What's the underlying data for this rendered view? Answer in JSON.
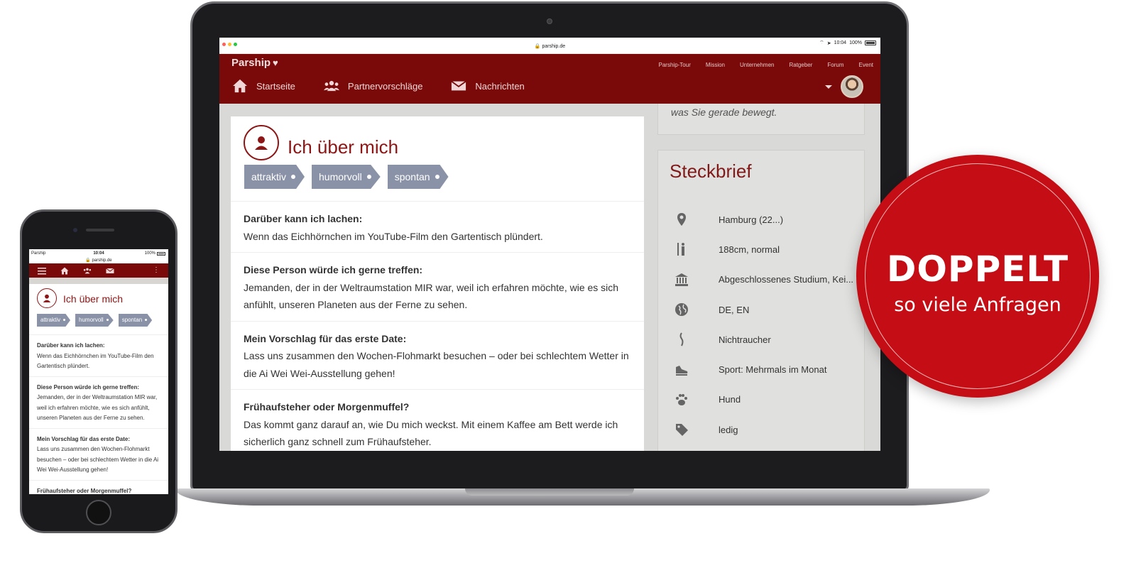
{
  "laptop": {
    "status_bar": {
      "url": "parship.de",
      "time": "10:04",
      "battery": "100%"
    },
    "header": {
      "logo": "Parship",
      "top_links": [
        "Parship-Tour",
        "Mission",
        "Unternehmen",
        "Ratgeber",
        "Forum",
        "Event"
      ],
      "nav": [
        "Startseite",
        "Partnervorschläge",
        "Nachrichten"
      ]
    },
    "profile": {
      "title": "Ich über mich",
      "tags": [
        "attraktiv",
        "humorvoll",
        "spontan"
      ],
      "qa": [
        {
          "q": "Darüber kann ich lachen:",
          "a": "Wenn das Eichhörnchen im YouTube-Film den Gartentisch plündert."
        },
        {
          "q": "Diese Person würde ich gerne treffen:",
          "a": "Jemanden, der in der Weltraumstation MIR war, weil ich erfahren möchte, wie es sich anfühlt, unseren Planeten aus der Ferne zu sehen."
        },
        {
          "q": "Mein Vorschlag für das erste Date:",
          "a": "Lass uns zusammen den Wochen-Flohmarkt besuchen – oder bei schlechtem Wetter in die Ai Wei Wei-Ausstellung gehen!"
        },
        {
          "q": "Frühaufsteher oder Morgenmuffel?",
          "a": "Das kommt ganz darauf an, wie Du mich weckst. Mit einem Kaffee am Bett werde ich sicherlich ganz schnell zum Frühaufsteher."
        }
      ]
    },
    "sidebar": {
      "top_text": "was Sie gerade bewegt.",
      "steckbrief_title": "Steckbrief",
      "items": [
        {
          "icon": "location-pin-icon",
          "value": "Hamburg (22...)"
        },
        {
          "icon": "height-icon",
          "value": "188cm, normal"
        },
        {
          "icon": "education-icon",
          "value": "Abgeschlossenes Studium, Kei..."
        },
        {
          "icon": "globe-icon",
          "value": "DE, EN"
        },
        {
          "icon": "smoke-icon",
          "value": "Nichtraucher"
        },
        {
          "icon": "shoe-icon",
          "value": "Sport: Mehrmals im Monat"
        },
        {
          "icon": "paw-icon",
          "value": "Hund"
        },
        {
          "icon": "tag-icon",
          "value": "ledig"
        }
      ]
    }
  },
  "phone": {
    "status_bar": {
      "carrier": "Parship",
      "time": "10:04",
      "battery": "100%",
      "url": "parship.de"
    },
    "profile": {
      "title": "Ich über mich",
      "tags": [
        "attraktiv",
        "humorvoll",
        "spontan"
      ],
      "qa": [
        {
          "q": "Darüber kann ich lachen:",
          "a": "Wenn das Eichhörnchen im YouTube-Film den Gartentisch plündert."
        },
        {
          "q": "Diese Person würde ich gerne treffen:",
          "a": "Jemanden, der in der Weltraumstation MIR war, weil ich erfahren möchte, wie es sich anfühlt, unseren Planeten aus der Ferne zu sehen."
        },
        {
          "q": "Mein Vorschlag für das erste Date:",
          "a": "Lass uns zusammen den Wochen-Flohmarkt besuchen – oder bei schlechtem Wetter in die Ai Wei Wei-Ausstellung gehen!"
        },
        {
          "q": "Frühaufsteher oder Morgenmuffel?",
          "a": ""
        }
      ]
    }
  },
  "promo_badge": {
    "big": "DOPPELT",
    "small": "so viele Anfragen"
  },
  "colors": {
    "brand": "#7a0a0a",
    "accent": "#8c1515",
    "tag": "#8a92a8",
    "badge": "#c40d14"
  }
}
